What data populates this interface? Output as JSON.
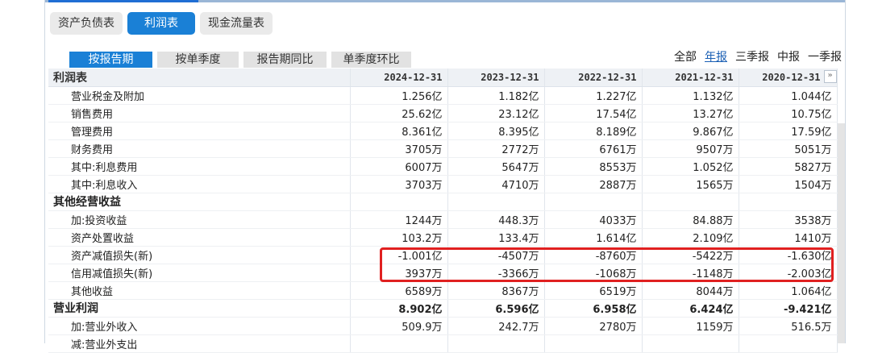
{
  "tabs_main": [
    "资产负债表",
    "利润表",
    "现金流量表"
  ],
  "tabs_sub": [
    "按报告期",
    "按单季度",
    "报告期同比",
    "单季度环比"
  ],
  "period_filters": [
    "全部",
    "年报",
    "三季报",
    "中报",
    "一季报"
  ],
  "active_period": "年报",
  "expand_icon": "»",
  "table": {
    "title": "利润表",
    "columns": [
      "2024-12-31",
      "2023-12-31",
      "2022-12-31",
      "2021-12-31",
      "2020-12-31"
    ],
    "rows": [
      {
        "label": "营业税金及附加",
        "values": [
          "1.256亿",
          "1.182亿",
          "1.227亿",
          "1.132亿",
          "1.044亿"
        ]
      },
      {
        "label": "销售费用",
        "values": [
          "25.62亿",
          "23.12亿",
          "17.54亿",
          "13.27亿",
          "10.75亿"
        ]
      },
      {
        "label": "管理费用",
        "values": [
          "8.361亿",
          "8.395亿",
          "8.189亿",
          "9.867亿",
          "17.59亿"
        ]
      },
      {
        "label": "财务费用",
        "values": [
          "3705万",
          "2772万",
          "6761万",
          "9507万",
          "5051万"
        ]
      },
      {
        "label": "其中:利息费用",
        "values": [
          "6007万",
          "5647万",
          "8553万",
          "1.052亿",
          "5827万"
        ]
      },
      {
        "label": "其中:利息收入",
        "values": [
          "3703万",
          "4710万",
          "2887万",
          "1565万",
          "1504万"
        ]
      },
      {
        "label": "其他经营收益",
        "values": [
          "",
          "",
          "",
          "",
          ""
        ]
      },
      {
        "label": "加:投资收益",
        "values": [
          "1244万",
          "448.3万",
          "4033万",
          "84.88万",
          "3538万"
        ]
      },
      {
        "label": "资产处置收益",
        "values": [
          "103.2万",
          "133.4万",
          "1.614亿",
          "2.109亿",
          "1410万"
        ]
      },
      {
        "label": "资产减值损失(新)",
        "values": [
          "-1.001亿",
          "-4507万",
          "-8760万",
          "-5422万",
          "-1.630亿"
        ]
      },
      {
        "label": "信用减值损失(新)",
        "values": [
          "3937万",
          "-3366万",
          "-1068万",
          "-1148万",
          "-2.003亿"
        ]
      },
      {
        "label": "其他收益",
        "values": [
          "6589万",
          "8367万",
          "6519万",
          "8044万",
          "1.064亿"
        ]
      },
      {
        "label": "营业利润",
        "values": [
          "8.902亿",
          "6.596亿",
          "6.958亿",
          "6.424亿",
          "-9.421亿"
        ]
      },
      {
        "label": "加:营业外收入",
        "values": [
          "509.9万",
          "242.7万",
          "2780万",
          "1159万",
          "516.5万"
        ]
      },
      {
        "label": "减:营业外支出",
        "values": [
          "",
          "",
          "",
          "",
          ""
        ]
      }
    ]
  }
}
